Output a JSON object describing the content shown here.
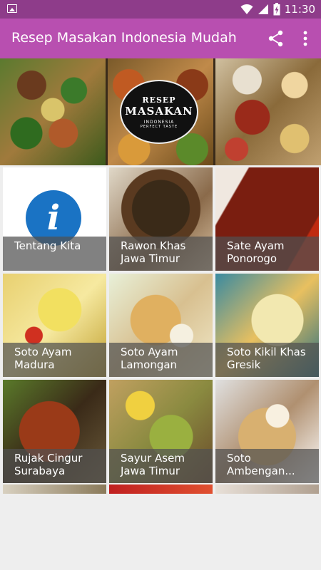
{
  "status_bar": {
    "time": "11:30",
    "icons": [
      "image-icon",
      "wifi-icon",
      "signal-icon",
      "battery-charging-icon"
    ]
  },
  "app_bar": {
    "title": "Resep Masakan Indonesia Mudah",
    "actions": [
      "share-icon",
      "more-vert-icon"
    ]
  },
  "banner": {
    "logo": {
      "line1": "RESEP",
      "line2": "MASAKAN",
      "line3": "INDONESIA",
      "line4": "PERFECT TASTE"
    }
  },
  "tiles": [
    {
      "label": "Tentang Kita"
    },
    {
      "label": "Rawon Khas\nJawa Timur"
    },
    {
      "label": "Sate Ayam\nPonorogo"
    },
    {
      "label": "Soto Ayam\nMadura"
    },
    {
      "label": "Soto Ayam\nLamongan"
    },
    {
      "label": "Soto Kikil Khas\nGresik"
    },
    {
      "label": "Rujak Cingur\nSurabaya"
    },
    {
      "label": "Sayur Asem\nJawa Timur"
    },
    {
      "label": "Soto\nAmbengan..."
    }
  ],
  "colors": {
    "status_bar": "#8e3c8a",
    "app_bar": "#b84fb0",
    "info_icon": "#1a73c4",
    "caption_overlay": "#505050"
  }
}
